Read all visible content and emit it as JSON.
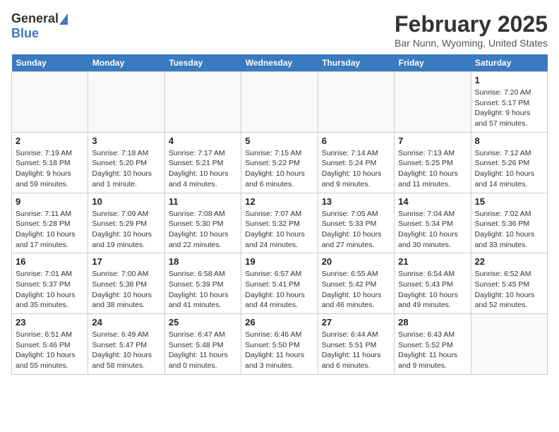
{
  "header": {
    "logo_general": "General",
    "logo_blue": "Blue",
    "month_title": "February 2025",
    "location": "Bar Nunn, Wyoming, United States"
  },
  "days_of_week": [
    "Sunday",
    "Monday",
    "Tuesday",
    "Wednesday",
    "Thursday",
    "Friday",
    "Saturday"
  ],
  "weeks": [
    [
      {
        "day": "",
        "info": ""
      },
      {
        "day": "",
        "info": ""
      },
      {
        "day": "",
        "info": ""
      },
      {
        "day": "",
        "info": ""
      },
      {
        "day": "",
        "info": ""
      },
      {
        "day": "",
        "info": ""
      },
      {
        "day": "1",
        "info": "Sunrise: 7:20 AM\nSunset: 5:17 PM\nDaylight: 9 hours and 57 minutes."
      }
    ],
    [
      {
        "day": "2",
        "info": "Sunrise: 7:19 AM\nSunset: 5:18 PM\nDaylight: 9 hours and 59 minutes."
      },
      {
        "day": "3",
        "info": "Sunrise: 7:18 AM\nSunset: 5:20 PM\nDaylight: 10 hours and 1 minute."
      },
      {
        "day": "4",
        "info": "Sunrise: 7:17 AM\nSunset: 5:21 PM\nDaylight: 10 hours and 4 minutes."
      },
      {
        "day": "5",
        "info": "Sunrise: 7:15 AM\nSunset: 5:22 PM\nDaylight: 10 hours and 6 minutes."
      },
      {
        "day": "6",
        "info": "Sunrise: 7:14 AM\nSunset: 5:24 PM\nDaylight: 10 hours and 9 minutes."
      },
      {
        "day": "7",
        "info": "Sunrise: 7:13 AM\nSunset: 5:25 PM\nDaylight: 10 hours and 11 minutes."
      },
      {
        "day": "8",
        "info": "Sunrise: 7:12 AM\nSunset: 5:26 PM\nDaylight: 10 hours and 14 minutes."
      }
    ],
    [
      {
        "day": "9",
        "info": "Sunrise: 7:11 AM\nSunset: 5:28 PM\nDaylight: 10 hours and 17 minutes."
      },
      {
        "day": "10",
        "info": "Sunrise: 7:09 AM\nSunset: 5:29 PM\nDaylight: 10 hours and 19 minutes."
      },
      {
        "day": "11",
        "info": "Sunrise: 7:08 AM\nSunset: 5:30 PM\nDaylight: 10 hours and 22 minutes."
      },
      {
        "day": "12",
        "info": "Sunrise: 7:07 AM\nSunset: 5:32 PM\nDaylight: 10 hours and 24 minutes."
      },
      {
        "day": "13",
        "info": "Sunrise: 7:05 AM\nSunset: 5:33 PM\nDaylight: 10 hours and 27 minutes."
      },
      {
        "day": "14",
        "info": "Sunrise: 7:04 AM\nSunset: 5:34 PM\nDaylight: 10 hours and 30 minutes."
      },
      {
        "day": "15",
        "info": "Sunrise: 7:02 AM\nSunset: 5:36 PM\nDaylight: 10 hours and 33 minutes."
      }
    ],
    [
      {
        "day": "16",
        "info": "Sunrise: 7:01 AM\nSunset: 5:37 PM\nDaylight: 10 hours and 35 minutes."
      },
      {
        "day": "17",
        "info": "Sunrise: 7:00 AM\nSunset: 5:38 PM\nDaylight: 10 hours and 38 minutes."
      },
      {
        "day": "18",
        "info": "Sunrise: 6:58 AM\nSunset: 5:39 PM\nDaylight: 10 hours and 41 minutes."
      },
      {
        "day": "19",
        "info": "Sunrise: 6:57 AM\nSunset: 5:41 PM\nDaylight: 10 hours and 44 minutes."
      },
      {
        "day": "20",
        "info": "Sunrise: 6:55 AM\nSunset: 5:42 PM\nDaylight: 10 hours and 46 minutes."
      },
      {
        "day": "21",
        "info": "Sunrise: 6:54 AM\nSunset: 5:43 PM\nDaylight: 10 hours and 49 minutes."
      },
      {
        "day": "22",
        "info": "Sunrise: 6:52 AM\nSunset: 5:45 PM\nDaylight: 10 hours and 52 minutes."
      }
    ],
    [
      {
        "day": "23",
        "info": "Sunrise: 6:51 AM\nSunset: 5:46 PM\nDaylight: 10 hours and 55 minutes."
      },
      {
        "day": "24",
        "info": "Sunrise: 6:49 AM\nSunset: 5:47 PM\nDaylight: 10 hours and 58 minutes."
      },
      {
        "day": "25",
        "info": "Sunrise: 6:47 AM\nSunset: 5:48 PM\nDaylight: 11 hours and 0 minutes."
      },
      {
        "day": "26",
        "info": "Sunrise: 6:46 AM\nSunset: 5:50 PM\nDaylight: 11 hours and 3 minutes."
      },
      {
        "day": "27",
        "info": "Sunrise: 6:44 AM\nSunset: 5:51 PM\nDaylight: 11 hours and 6 minutes."
      },
      {
        "day": "28",
        "info": "Sunrise: 6:43 AM\nSunset: 5:52 PM\nDaylight: 11 hours and 9 minutes."
      },
      {
        "day": "",
        "info": ""
      }
    ]
  ]
}
